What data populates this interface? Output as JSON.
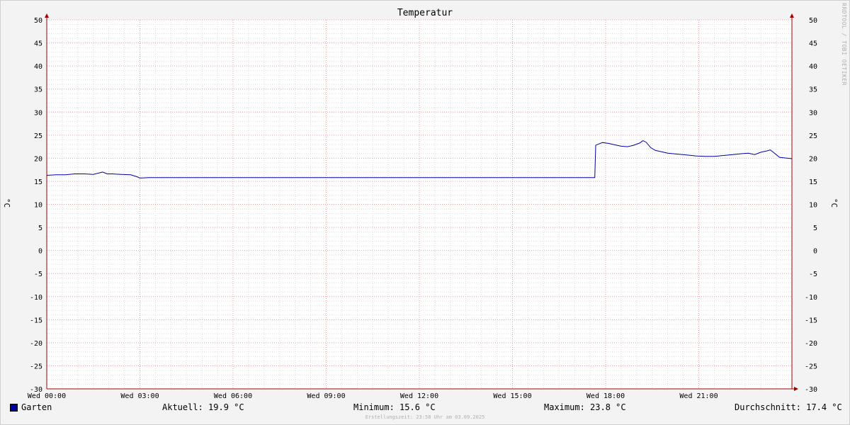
{
  "chart_data": {
    "type": "line",
    "title": "Temperatur",
    "ylabel": "°C",
    "ylim": [
      -30,
      50
    ],
    "yticks": [
      50,
      45,
      40,
      35,
      30,
      25,
      20,
      15,
      10,
      5,
      0,
      -5,
      -10,
      -15,
      -20,
      -25,
      -30
    ],
    "xlim": [
      0,
      24
    ],
    "xtick_labels": [
      {
        "hour": 0,
        "label": "Wed 00:00"
      },
      {
        "hour": 3,
        "label": "Wed 03:00"
      },
      {
        "hour": 6,
        "label": "Wed 06:00"
      },
      {
        "hour": 9,
        "label": "Wed 09:00"
      },
      {
        "hour": 12,
        "label": "Wed 12:00"
      },
      {
        "hour": 15,
        "label": "Wed 15:00"
      },
      {
        "hour": 18,
        "label": "Wed 18:00"
      },
      {
        "hour": 21,
        "label": "Wed 21:00"
      }
    ],
    "grid": true,
    "series": [
      {
        "name": "Garten",
        "color": "#0000a0",
        "x": [
          0,
          0.3,
          0.6,
          0.9,
          1.2,
          1.5,
          1.8,
          1.95,
          2.1,
          2.4,
          2.7,
          2.9,
          3.0,
          3.3,
          6,
          9,
          12,
          15,
          17.65,
          17.68,
          17.75,
          17.9,
          18.1,
          18.3,
          18.5,
          18.7,
          18.9,
          19.1,
          19.2,
          19.3,
          19.45,
          19.6,
          19.8,
          20.0,
          20.3,
          20.6,
          20.9,
          21.2,
          21.5,
          21.8,
          22.1,
          22.4,
          22.6,
          22.8,
          23.0,
          23.2,
          23.3,
          23.4,
          23.6,
          24.0
        ],
        "y": [
          16.3,
          16.4,
          16.4,
          16.6,
          16.6,
          16.5,
          17.0,
          16.6,
          16.6,
          16.5,
          16.4,
          16.0,
          15.7,
          15.8,
          15.8,
          15.8,
          15.8,
          15.8,
          15.8,
          22.8,
          23.0,
          23.4,
          23.2,
          22.9,
          22.6,
          22.5,
          22.8,
          23.3,
          23.8,
          23.5,
          22.3,
          21.7,
          21.4,
          21.1,
          20.9,
          20.7,
          20.5,
          20.4,
          20.4,
          20.6,
          20.8,
          21.0,
          21.1,
          20.8,
          21.3,
          21.6,
          21.8,
          21.3,
          20.2,
          19.9
        ]
      }
    ]
  },
  "legend": {
    "series_name": "Garten",
    "current": "Aktuell: 19.9 °C",
    "minimum": "Minimum: 15.6 °C",
    "maximum": "Maximum: 23.8 °C",
    "average": "Durchschnitt: 17.4 °C"
  },
  "watermark": "RRDTOOL / TOBI OETIKER",
  "footer": "Erstellungszeit: 23:58 Uhr am 03.09.2025"
}
